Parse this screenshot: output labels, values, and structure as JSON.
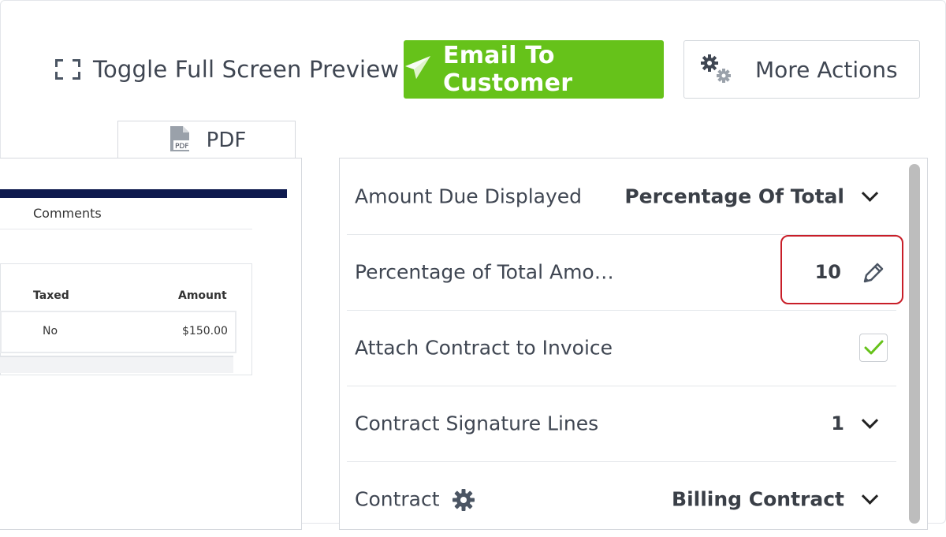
{
  "toolbar": {
    "toggle_fullscreen_label": "Toggle Full Screen Preview",
    "email_label": "Email To Customer",
    "more_actions_label": "More Actions",
    "accent_color": "#66c21a"
  },
  "preview": {
    "tab_label": "PDF",
    "comments_label": "Comments",
    "table": {
      "headers": [
        "Taxed",
        "Amount"
      ],
      "rows": [
        [
          "No",
          "$150.00"
        ]
      ]
    }
  },
  "settings": {
    "rows": [
      {
        "label": "Amount Due Displayed",
        "value": "Percentage Of Total",
        "control": "dropdown"
      },
      {
        "label": "Percentage of Total Amo…",
        "value": "10",
        "control": "editable"
      },
      {
        "label": "Attach Contract to Invoice",
        "value": "",
        "control": "checkbox",
        "checked": true
      },
      {
        "label": "Contract Signature Lines",
        "value": "1",
        "control": "dropdown"
      },
      {
        "label": "Contract",
        "value": "Billing Contract",
        "control": "dropdown",
        "icon": "gear-icon"
      }
    ],
    "highlight_color": "#c81e28"
  }
}
